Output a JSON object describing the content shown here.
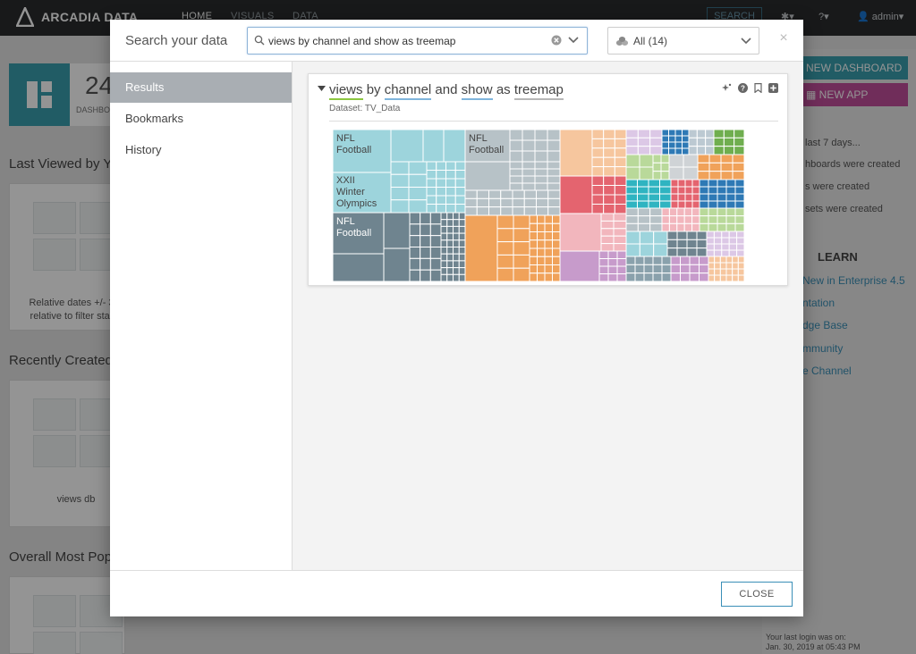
{
  "app": {
    "brand": "ARCADIA DATA",
    "nav": [
      "HOME",
      "VISUALS",
      "DATA"
    ],
    "search_label": "SEARCH",
    "user": "admin"
  },
  "background": {
    "stat_number": "24",
    "stat_label": "DASHBO",
    "section_last_viewed": "Last Viewed by Y",
    "section_recently_created": "Recently Created",
    "section_most_popular": "Overall Most Pop",
    "card1_caption_1": "Relative dates +/- 3",
    "card1_caption_2": "relative to filter star",
    "card2_caption": "views db",
    "new_dashboard": "NEW DASHBOARD",
    "new_app": "NEW APP",
    "activity_heading": "last 7 days...",
    "activity_lines": [
      "hboards were created",
      "s were created",
      "sets were created"
    ],
    "learn_heading": "LEARN",
    "learn_links": [
      "New in Enterprise 4.5",
      "ntation",
      "dge Base",
      "mmunity",
      "e Channel"
    ],
    "login_line1": "Your last login was on:",
    "login_line2": "Jan. 30, 2019 at 05:43 PM"
  },
  "modal": {
    "title": "Search your data",
    "search_value": "views by channel and show as treemap",
    "filter_value": "All (14)",
    "close_x": "×",
    "sidebar_items": [
      "Results",
      "Bookmarks",
      "History"
    ],
    "result": {
      "title_tokens": [
        "views",
        "by",
        "channel",
        "and",
        "show",
        "as",
        "treemap"
      ],
      "dataset": "Dataset: TV_Data",
      "treemap_labels": {
        "a": [
          "NFL",
          "Football"
        ],
        "b": [
          "XXII",
          "Winter",
          "Olympics"
        ],
        "c": [
          "NFL",
          "Football"
        ],
        "d": [
          "NFL",
          "Football"
        ]
      }
    },
    "close_button": "CLOSE"
  },
  "colors": {
    "teal": "#3a9fae",
    "pink_button": "#c24f9b",
    "link_blue": "#3a8fb7"
  }
}
